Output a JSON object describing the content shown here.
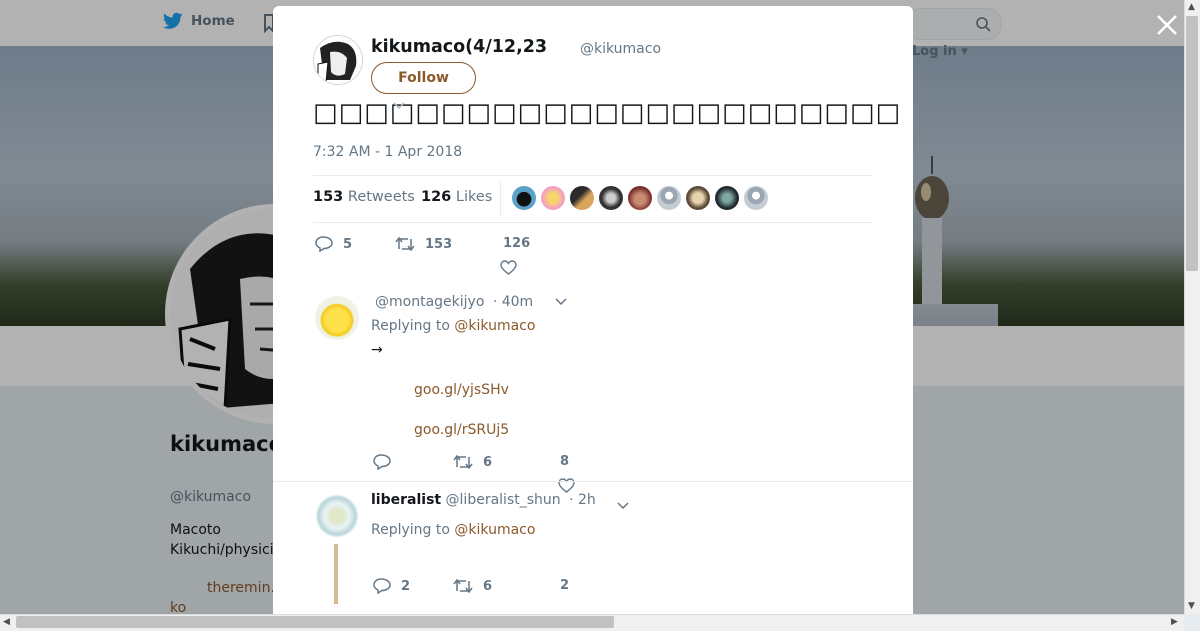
{
  "nav": {
    "home_label": "Home",
    "login_label": "Log in"
  },
  "profile": {
    "name": "kikumaco",
    "handle": "@kikumaco",
    "bio_line1": "Macoto",
    "bio_line2": "Kikuchi/physici",
    "link_text": "theremin.",
    "link_text2": "ko"
  },
  "tweet": {
    "author_name": "kikumaco(4/12,23",
    "author_handle": "@kikumaco",
    "follow_label": "Follow",
    "text": "□□□□□□□□□□□□□□□□□□□□□□□□□□□□□□□□□□□□□□□□□□□□□□□□□",
    "time": "7:32 AM - 1 Apr 2018",
    "retweets_count": "153",
    "retweets_label": "Retweets",
    "likes_count": "126",
    "likes_label": "Likes",
    "reply_count": "5",
    "retweet_action_count": "153",
    "like_action_count": "126"
  },
  "replies": [
    {
      "name": "",
      "handle": "@montagekijyo",
      "time": "· 40m",
      "replying_label": "Replying to",
      "replying_to": "@kikumaco",
      "body_line1": "→",
      "link1": "goo.gl/yjsSHv",
      "link2": "goo.gl/rSRUj5",
      "reply_count": "",
      "retweet_count": "6",
      "like_count": "8"
    },
    {
      "name": "liberalist",
      "handle": "@liberalist_shun",
      "time": "· 2h",
      "replying_label": "Replying to",
      "replying_to": "@kikumaco",
      "reply_count": "2",
      "retweet_count": "6",
      "like_count": "2"
    }
  ],
  "colors": {
    "accent": "#8a5a2b",
    "muted": "#657786",
    "twitter_blue": "#1da1f2"
  }
}
